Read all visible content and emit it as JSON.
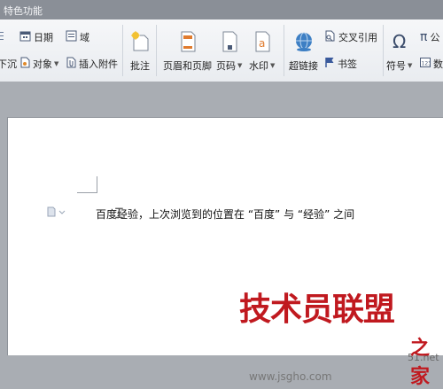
{
  "titlebar": {
    "title": "特色功能"
  },
  "ribbon": {
    "date_label": "日期",
    "field_label": "域",
    "sink_label": "下沉",
    "object_label": "对象",
    "attach_label": "插入附件",
    "comment_label": "批注",
    "header_footer_label": "页眉和页脚",
    "page_number_label": "页码",
    "watermark_label": "水印",
    "hyperlink_label": "超链接",
    "cross_ref_label": "交叉引用",
    "bookmark_label": "书签",
    "symbol_label": "符号",
    "formula_label": "公",
    "number_label": "数"
  },
  "document": {
    "text": "百度经验，上次浏览到的位置在 “百度” 与 “经验” 之间"
  },
  "watermark": {
    "logo_text": "技术员联盟",
    "site_text": "www.jsgho.com",
    "site_short": "51.net",
    "home_text": "之家"
  }
}
